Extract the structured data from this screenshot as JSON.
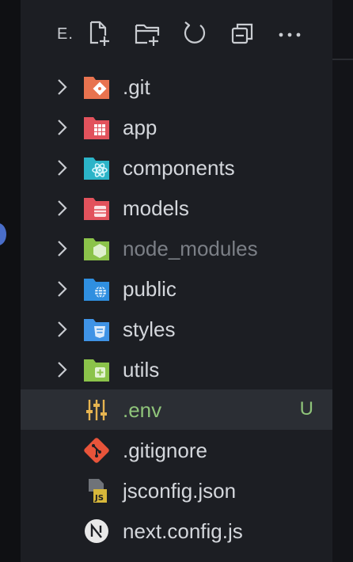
{
  "explorer": {
    "title": "E.",
    "toolbar": [
      {
        "name": "new-file-icon"
      },
      {
        "name": "new-folder-icon"
      },
      {
        "name": "refresh-icon"
      },
      {
        "name": "collapse-all-icon"
      },
      {
        "name": "more-actions-icon"
      }
    ]
  },
  "tree": {
    "items": [
      {
        "label": ".git",
        "type": "folder",
        "icon": "git-folder-icon",
        "color": "#e8734f"
      },
      {
        "label": "app",
        "type": "folder",
        "icon": "app-folder-icon",
        "color": "#e2525c"
      },
      {
        "label": "components",
        "type": "folder",
        "icon": "react-folder-icon",
        "color": "#2bb4c8"
      },
      {
        "label": "models",
        "type": "folder",
        "icon": "database-folder-icon",
        "color": "#e2525c"
      },
      {
        "label": "node_modules",
        "type": "folder",
        "icon": "node-folder-icon",
        "color": "#8bc34a"
      },
      {
        "label": "public",
        "type": "folder",
        "icon": "web-folder-icon",
        "color": "#2f8fe0"
      },
      {
        "label": "styles",
        "type": "folder",
        "icon": "css-folder-icon",
        "color": "#3f93e6"
      },
      {
        "label": "utils",
        "type": "folder",
        "icon": "utils-folder-icon",
        "color": "#8bc34a"
      },
      {
        "label": ".env",
        "type": "file",
        "icon": "env-settings-icon",
        "color": "#e6b450",
        "status": "U"
      },
      {
        "label": ".gitignore",
        "type": "file",
        "icon": "git-icon",
        "color": "#e8543a"
      },
      {
        "label": "jsconfig.json",
        "type": "file",
        "icon": "js-config-icon",
        "color": "#d7b73a"
      },
      {
        "label": "next.config.js",
        "type": "file",
        "icon": "nextjs-icon",
        "color": "#e8e8e8"
      }
    ]
  }
}
